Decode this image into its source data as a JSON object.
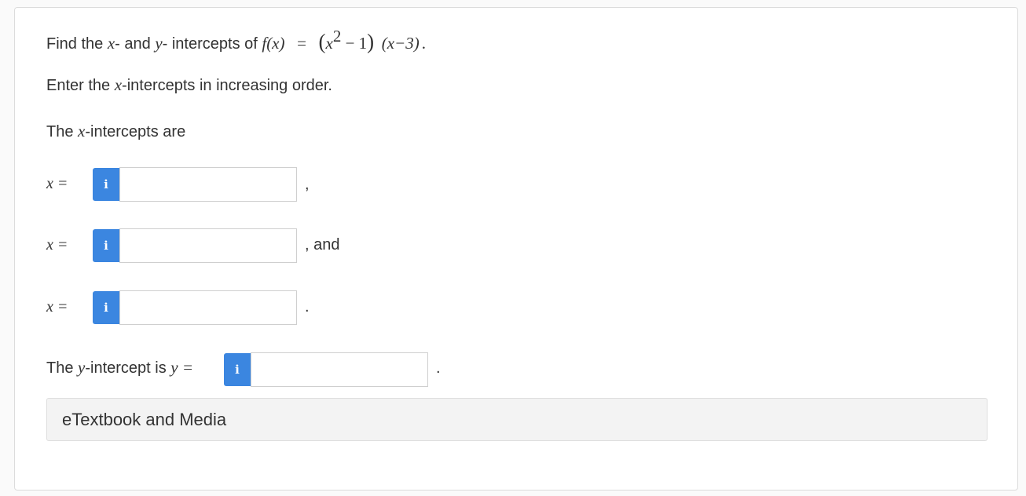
{
  "question": {
    "prompt_prefix": "Find the ",
    "var_x": "x",
    "prompt_and": "- and ",
    "var_y": "y",
    "prompt_suffix": "- intercepts of ",
    "function_lhs": "f(x)",
    "equals": "=",
    "paren_open": "(",
    "factor1_base": "x",
    "factor1_exp": "2",
    "factor1_rest": " − 1",
    "paren_close": ")",
    "factor2": "(x−3)",
    "end_period": "."
  },
  "instruction": {
    "prefix": "Enter the ",
    "var": "x",
    "suffix": "-intercepts in increasing order."
  },
  "x_intro": {
    "prefix": "The ",
    "var": "x",
    "suffix": "-intercepts are"
  },
  "x_rows": [
    {
      "label": "x =",
      "info_icon": "i",
      "value": "",
      "after": ","
    },
    {
      "label": "x =",
      "info_icon": "i",
      "value": "",
      "after": ", and"
    },
    {
      "label": "x =",
      "info_icon": "i",
      "value": "",
      "after": "."
    }
  ],
  "y_row": {
    "prefix": "The ",
    "var": "y",
    "suffix": "-intercept is ",
    "label": "y =",
    "info_icon": "i",
    "value": "",
    "after": "."
  },
  "media_button": "eTextbook and Media",
  "colors": {
    "info_button": "#3b86e0",
    "card_border": "#dcdcdc",
    "media_bg": "#f3f3f3"
  }
}
